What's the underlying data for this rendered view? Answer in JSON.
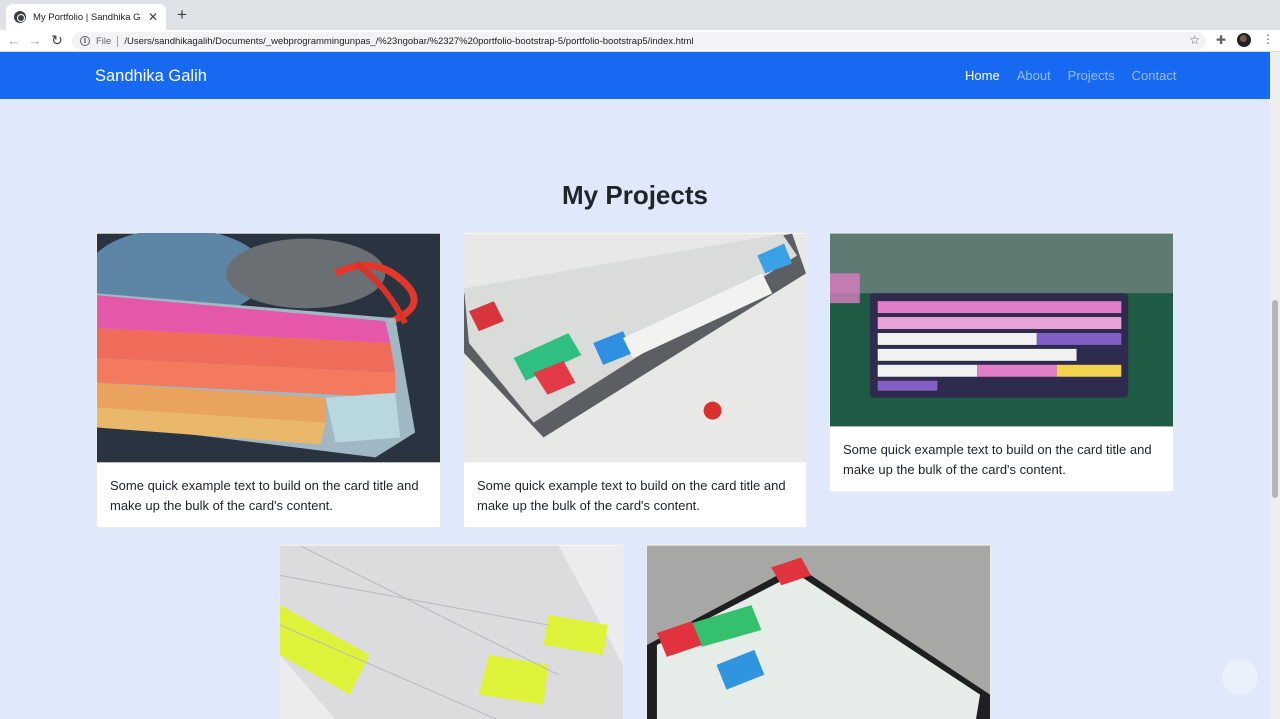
{
  "browser": {
    "tab_title": "My Portfolio | Sandhika Galih",
    "tab_close": "✕",
    "new_tab": "+",
    "scheme_label": "File",
    "url": "/Users/sandhikagalih/Documents/_webprogrammingunpas_/%23ngobar/%2327%20portfolio-bootstrap-5/portfolio-bootstrap5/index.html"
  },
  "navbar": {
    "brand": "Sandhika Galih",
    "links": [
      {
        "label": "Home",
        "active": true
      },
      {
        "label": "About",
        "active": false
      },
      {
        "label": "Projects",
        "active": false
      },
      {
        "label": "Contact",
        "active": false
      }
    ]
  },
  "projects": {
    "title": "My Projects",
    "cards": [
      {
        "text": "Some quick example text to build on the card title and make up the bulk of the card's content.",
        "image": "keyboard-pink-orange-photo"
      },
      {
        "text": "Some quick example text to build on the card title and make up the bulk of the card's content.",
        "image": "keyboard-grey-white-photo"
      },
      {
        "text": "Some quick example text to build on the card title and make up the bulk of the card's content.",
        "image": "keyboard-purple-pink-photo"
      },
      {
        "text": "",
        "image": "keyboard-white-yellow-photo"
      },
      {
        "text": "",
        "image": "keyboard-white-red-teal-photo"
      }
    ]
  },
  "colors": {
    "navbar": "#1769f2",
    "page_background": "#dfe9fb"
  }
}
